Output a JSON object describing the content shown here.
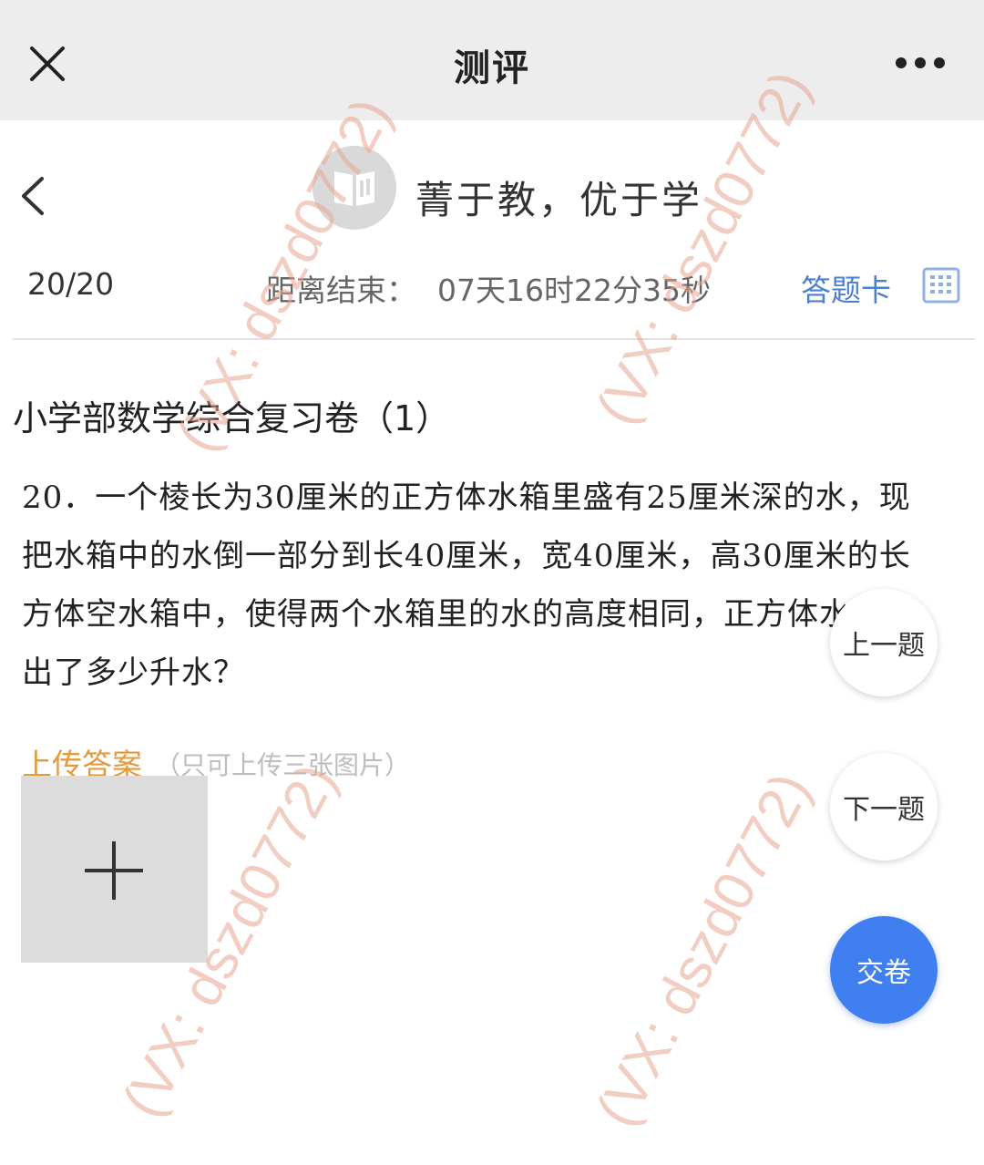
{
  "appbar": {
    "title": "测评",
    "close_icon": "close-icon",
    "more_icon": "more-icon"
  },
  "header": {
    "slogan": "菁于教，优于学",
    "back_icon": "chevron-left-icon",
    "logo_icon": "book-logo-icon"
  },
  "status": {
    "progress": "20/20",
    "countdown_label": "距离结束：",
    "countdown_value": "07天16时22分35秒",
    "answer_card_label": "答题卡",
    "answer_card_icon": "grid-icon"
  },
  "paper": {
    "title": "小学部数学综合复习卷（1）"
  },
  "question": {
    "line1": "20．一个棱长为30厘米的正方体水箱里盛有25厘米深的水，现",
    "line2": "把水箱中的水倒一部分到长40厘米，宽40厘米，高30厘米的长",
    "line3": "方体空水箱中，使得两个水箱里的水的高度相同，正方体水箱倒",
    "line4": "出了多少升水？"
  },
  "upload": {
    "label": "上传答案",
    "hint": "（只可上传三张图片）",
    "add_icon": "plus-icon"
  },
  "buttons": {
    "prev": "上一题",
    "next": "下一题",
    "submit": "交卷"
  },
  "watermark": {
    "text": "(VX: dszd0772)"
  },
  "colors": {
    "appbar_bg": "#ededed",
    "accent_blue": "#4a7fd1",
    "submit_blue": "#3f7ff0",
    "upload_orange": "#e39b3e",
    "watermark": "#e8a48f"
  }
}
